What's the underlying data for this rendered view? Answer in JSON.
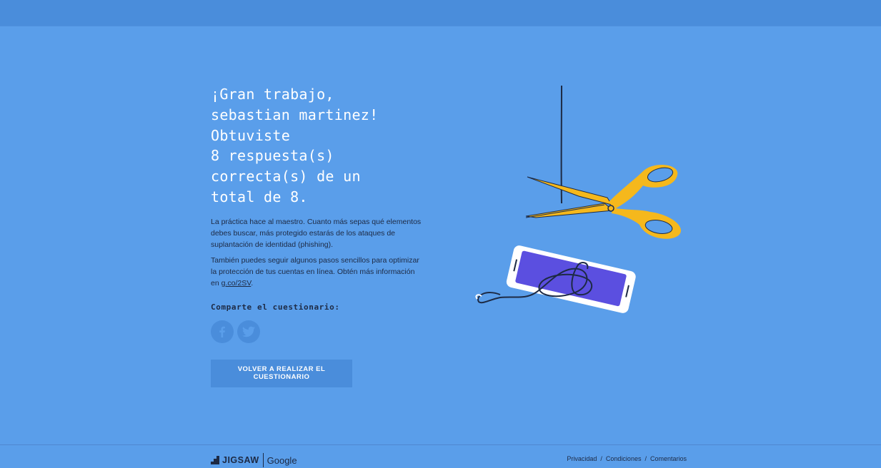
{
  "headline": {
    "lines": [
      "¡Gran trabajo,",
      "sebastian martinez!",
      "Obtuviste",
      "8 respuesta(s)",
      "correcta(s) de un",
      "total de 8."
    ]
  },
  "body": {
    "paragraph1": "La práctica hace al maestro. Cuanto más sepas qué elementos debes buscar, más protegido estarás de los ataques de suplantación de identidad (phishing).",
    "paragraph2_prefix": "También puedes seguir algunos pasos sencillos para optimizar la protección de tus cuentas en línea. Obtén más información en ",
    "paragraph2_link": "g.co/2SV",
    "paragraph2_suffix": "."
  },
  "share": {
    "label": "Comparte el cuestionario:",
    "buttons": [
      {
        "icon": "facebook-icon"
      },
      {
        "icon": "twitter-icon"
      }
    ]
  },
  "retry_button": {
    "label": "VOLVER A REALIZAR EL CUESTIONARIO"
  },
  "footer": {
    "brand": "JIGSAW",
    "partner": "Google",
    "links": [
      "Privacidad",
      "Condiciones",
      "Comentarios"
    ],
    "separator": "/"
  },
  "colors": {
    "background": "#5a9eea",
    "topbar": "#4a8ddb",
    "headline": "#ffffff",
    "body_text": "#1d2a44",
    "scissors": "#f5b81c",
    "phone_screen": "#5b4fe0"
  }
}
